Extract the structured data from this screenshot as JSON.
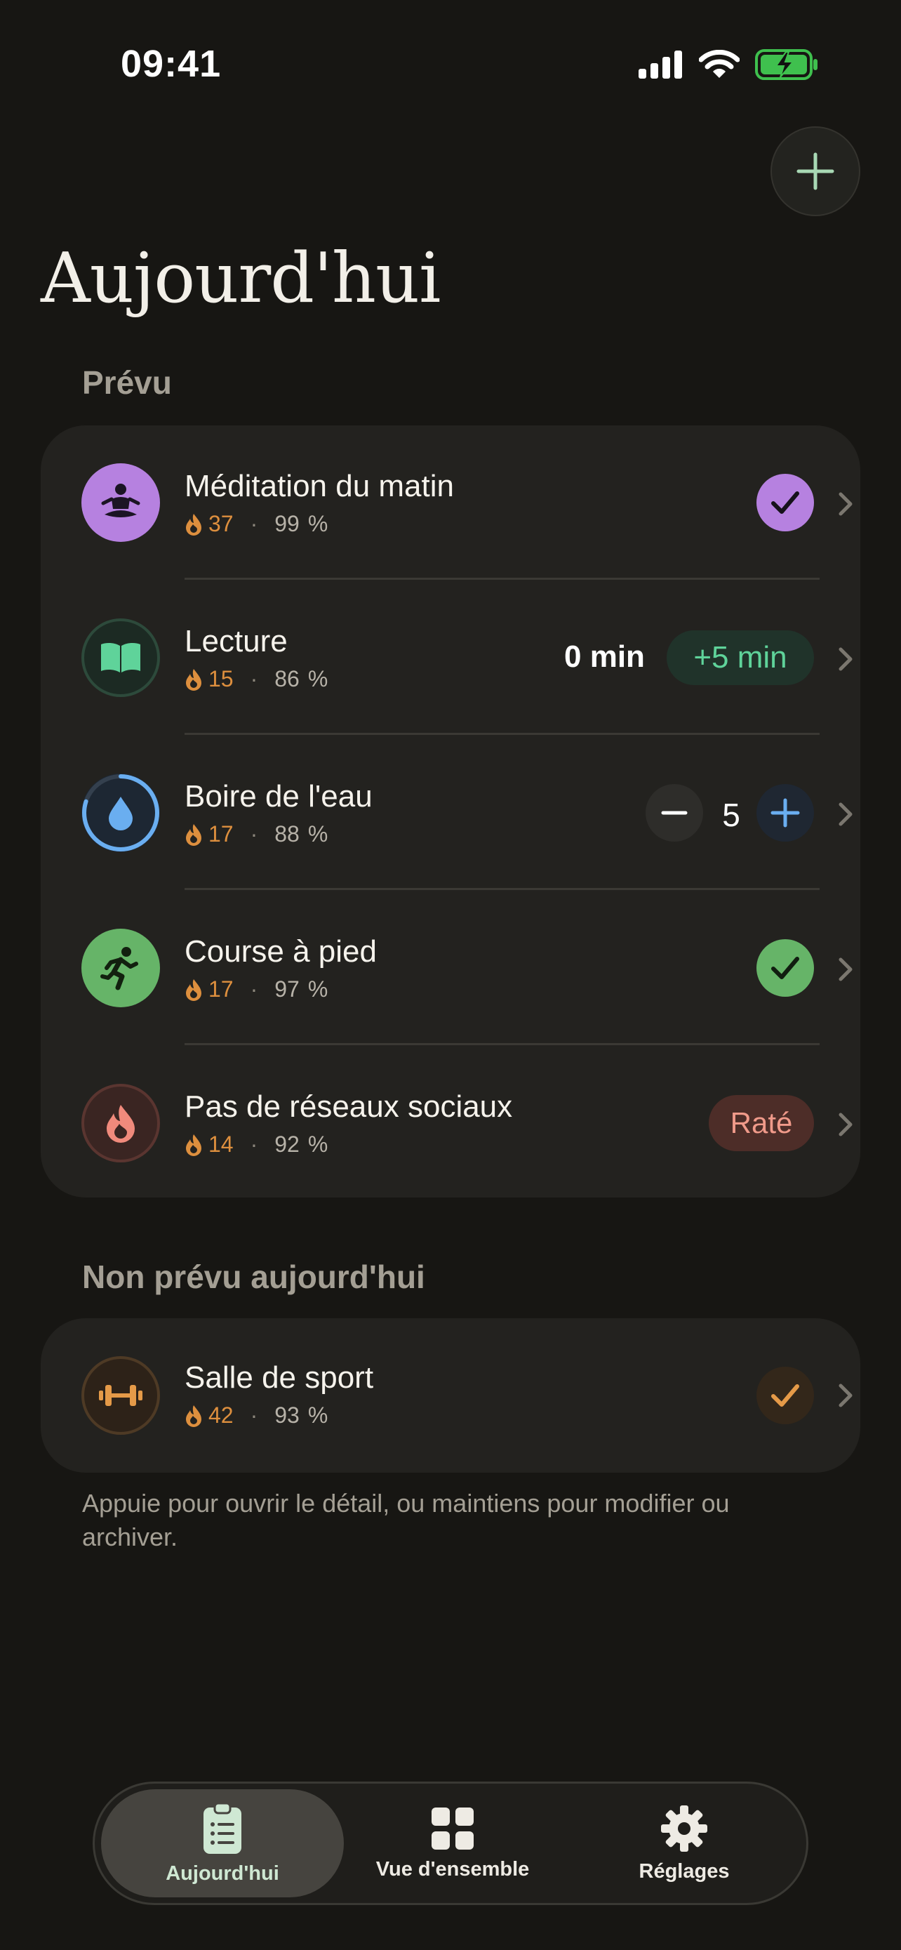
{
  "status_bar": {
    "time": "09:41"
  },
  "header": {
    "title": "Aujourd'hui",
    "add_icon": "plus-icon"
  },
  "sections": {
    "planned": "Prévu",
    "unplanned": "Non prévu aujourd'hui"
  },
  "colors": {
    "background": "#171613",
    "card": "#23221f",
    "streak": "#dd8f3e",
    "meditation": "#b681e0",
    "reading": "#5fd39a",
    "water": "#6aaef0",
    "running": "#66b468",
    "social": "#f08a7c",
    "gym": "#e59a48"
  },
  "habits_planned": [
    {
      "name": "Méditation du matin",
      "icon": "meditation-icon",
      "streak": "37",
      "rate": "99",
      "unit": "%",
      "action": "checked"
    },
    {
      "name": "Lecture",
      "icon": "book-icon",
      "streak": "15",
      "rate": "86",
      "unit": "%",
      "action": "timer",
      "minutes": "0 min",
      "add_label": "+5 min"
    },
    {
      "name": "Boire de l'eau",
      "icon": "water-drop-icon",
      "streak": "17",
      "rate": "88",
      "unit": "%",
      "action": "counter",
      "count": "5",
      "progress": 0.8
    },
    {
      "name": "Course à pied",
      "icon": "running-icon",
      "streak": "17",
      "rate": "97",
      "unit": "%",
      "action": "checked"
    },
    {
      "name": "Pas de réseaux sociaux",
      "icon": "flame-icon",
      "streak": "14",
      "rate": "92",
      "unit": "%",
      "action": "missed",
      "status": "Raté"
    }
  ],
  "habits_unplanned": [
    {
      "name": "Salle de sport",
      "icon": "dumbbell-icon",
      "streak": "42",
      "rate": "93",
      "unit": "%",
      "action": "checked"
    }
  ],
  "hint": "Appuie pour ouvrir le détail, ou maintiens pour modifier ou archiver.",
  "tabs": [
    {
      "label": "Aujourd'hui",
      "icon": "clipboard-list-icon",
      "active": true
    },
    {
      "label": "Vue d'ensemble",
      "icon": "grid-icon",
      "active": false
    },
    {
      "label": "Réglages",
      "icon": "gear-icon",
      "active": false
    }
  ]
}
